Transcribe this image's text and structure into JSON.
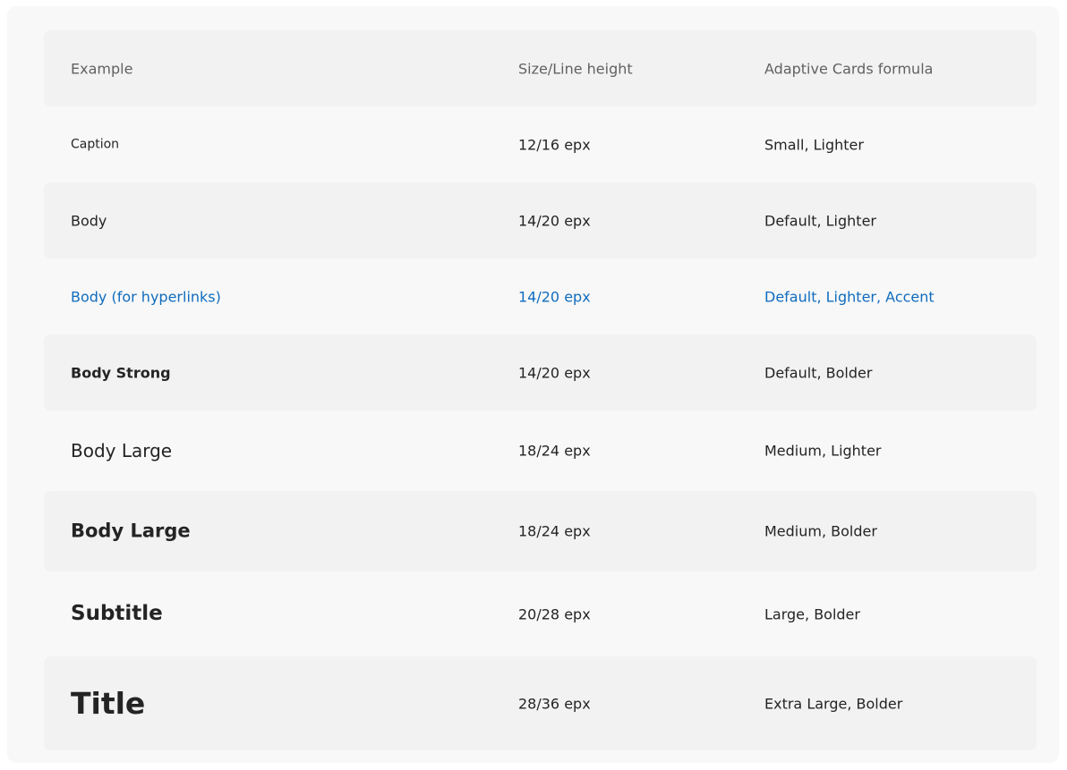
{
  "table": {
    "headers": [
      "Example",
      "Size/Line height",
      "Adaptive Cards formula"
    ],
    "rows": [
      {
        "example": "Caption",
        "size": "12/16 epx",
        "formula": "Small, Lighter"
      },
      {
        "example": "Body",
        "size": "14/20 epx",
        "formula": "Default, Lighter"
      },
      {
        "example": "Body (for hyperlinks)",
        "size": "14/20 epx",
        "formula": "Default, Lighter, Accent"
      },
      {
        "example": "Body Strong",
        "size": "14/20 epx",
        "formula": "Default, Bolder"
      },
      {
        "example": "Body Large",
        "size": "18/24 epx",
        "formula": "Medium, Lighter"
      },
      {
        "example": "Body Large",
        "size": "18/24 epx",
        "formula": "Medium, Bolder"
      },
      {
        "example": "Subtitle",
        "size": "20/28 epx",
        "formula": "Large, Bolder"
      },
      {
        "example": "Title",
        "size": "28/36 epx",
        "formula": "Extra Large, Bolder"
      }
    ]
  },
  "colors": {
    "panel_background": "#f8f8f8",
    "shaded_row": "#f2f2f2",
    "accent": "#0f6cbd",
    "header_text": "#616161",
    "text": "#242424"
  }
}
